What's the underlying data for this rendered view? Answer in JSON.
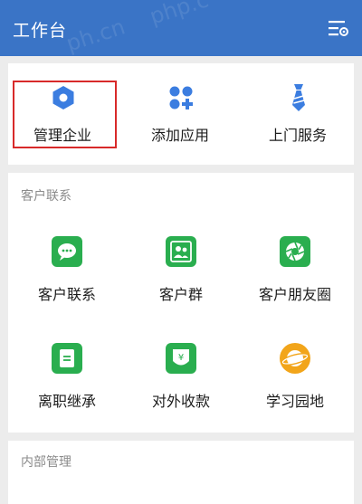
{
  "header": {
    "title": "工作台",
    "menu_icon": "list-settings-icon",
    "background": "#3a74c6"
  },
  "quick_actions": [
    {
      "label": "管理企业",
      "icon": "hexagon-icon",
      "color": "#3b7de0",
      "highlighted": true
    },
    {
      "label": "添加应用",
      "icon": "grid-add-icon",
      "color": "#3b7de0"
    },
    {
      "label": "上门服务",
      "icon": "tie-icon",
      "color": "#3b7de0"
    }
  ],
  "customer_section": {
    "title": "客户联系",
    "items": [
      {
        "label": "客户联系",
        "icon": "wechat-icon",
        "color": "#2aae4f"
      },
      {
        "label": "客户群",
        "icon": "group-icon",
        "color": "#2aae4f"
      },
      {
        "label": "客户朋友圈",
        "icon": "moments-icon",
        "color": "#2aae4f"
      },
      {
        "label": "离职继承",
        "icon": "transfer-icon",
        "color": "#2aae4f"
      },
      {
        "label": "对外收款",
        "icon": "payment-icon",
        "color": "#2aae4f"
      },
      {
        "label": "学习园地",
        "icon": "planet-icon",
        "color": "#f2a51a"
      }
    ]
  },
  "internal_section": {
    "title": "内部管理"
  }
}
